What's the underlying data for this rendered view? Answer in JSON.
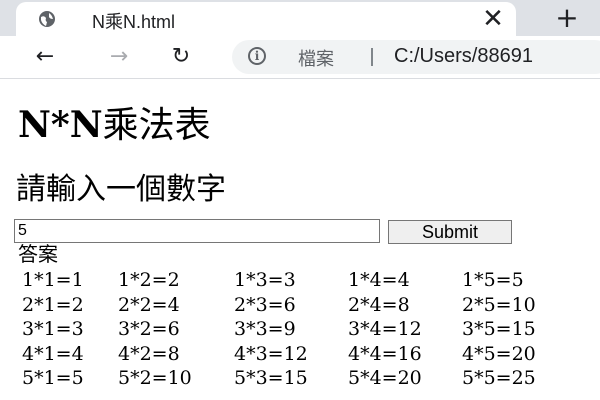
{
  "browser": {
    "tab_title": "N乘N.html",
    "close_symbol": "✕",
    "new_tab_symbol": "+",
    "file_label": "檔案",
    "url": "C:/Users/88691",
    "back_symbol": "←",
    "forward_symbol": "→",
    "reload_symbol": "↻",
    "info_symbol": "i"
  },
  "page": {
    "title_latin": "N*N",
    "title_cjk": "乘法表",
    "subtitle": "請輸入一個數字",
    "input_value": "5",
    "submit_label": "Submit",
    "answer_label": "答案"
  },
  "table": {
    "rows": [
      [
        "1*1=1",
        "1*2=2",
        "1*3=3",
        "1*4=4",
        "1*5=5"
      ],
      [
        "2*1=2",
        "2*2=4",
        "2*3=6",
        "2*4=8",
        "2*5=10"
      ],
      [
        "3*1=3",
        "3*2=6",
        "3*3=9",
        "3*4=12",
        "3*5=15"
      ],
      [
        "4*1=4",
        "4*2=8",
        "4*3=12",
        "4*4=16",
        "4*5=20"
      ],
      [
        "5*1=5",
        "5*2=10",
        "5*3=15",
        "5*4=20",
        "5*5=25"
      ]
    ]
  }
}
